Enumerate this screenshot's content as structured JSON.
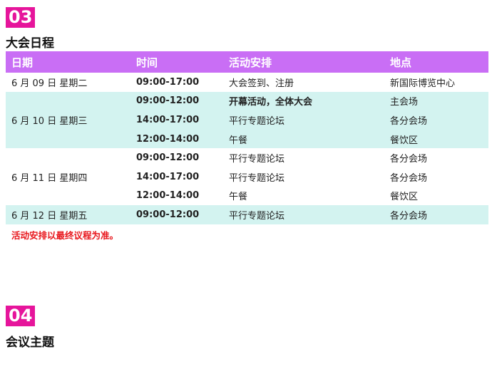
{
  "section3": {
    "number": "03",
    "title": "大会日程"
  },
  "table": {
    "headers": [
      "日期",
      "时间",
      "活动安排",
      "地点"
    ],
    "days": [
      {
        "date": "6 月 09 日  星期二",
        "rows": [
          {
            "time": "09:00-17:00",
            "activity": "大会签到、注册",
            "location": "新国际博览中心",
            "bold": false
          }
        ]
      },
      {
        "date": "6 月 10 日  星期三",
        "rows": [
          {
            "time": "09:00-12:00",
            "activity": "开幕活动，全体大会",
            "location": "主会场",
            "bold": true
          },
          {
            "time": "14:00-17:00",
            "activity": "平行专题论坛",
            "location": "各分会场",
            "bold": false
          },
          {
            "time": "12:00-14:00",
            "activity": "午餐",
            "location": "餐饮区",
            "bold": false
          }
        ]
      },
      {
        "date": "6 月 11 日  星期四",
        "rows": [
          {
            "time": "09:00-12:00",
            "activity": "平行专题论坛",
            "location": "各分会场",
            "bold": false
          },
          {
            "time": "14:00-17:00",
            "activity": "平行专题论坛",
            "location": "各分会场",
            "bold": false
          },
          {
            "time": "12:00-14:00",
            "activity": "午餐",
            "location": "餐饮区",
            "bold": false
          }
        ]
      },
      {
        "date": "6 月 12 日  星期五",
        "rows": [
          {
            "time": "09:00-12:00",
            "activity": "平行专题论坛",
            "location": "各分会场",
            "bold": false
          }
        ]
      }
    ]
  },
  "note": "活动安排以最终议程为准。",
  "section4": {
    "number": "04",
    "title": "会议主题"
  },
  "colors": {
    "section_badge": "#e6159b",
    "header_bg": "#c96ef5",
    "row_alt_bg": "#d3f3f0",
    "note_text": "#e8161c"
  }
}
